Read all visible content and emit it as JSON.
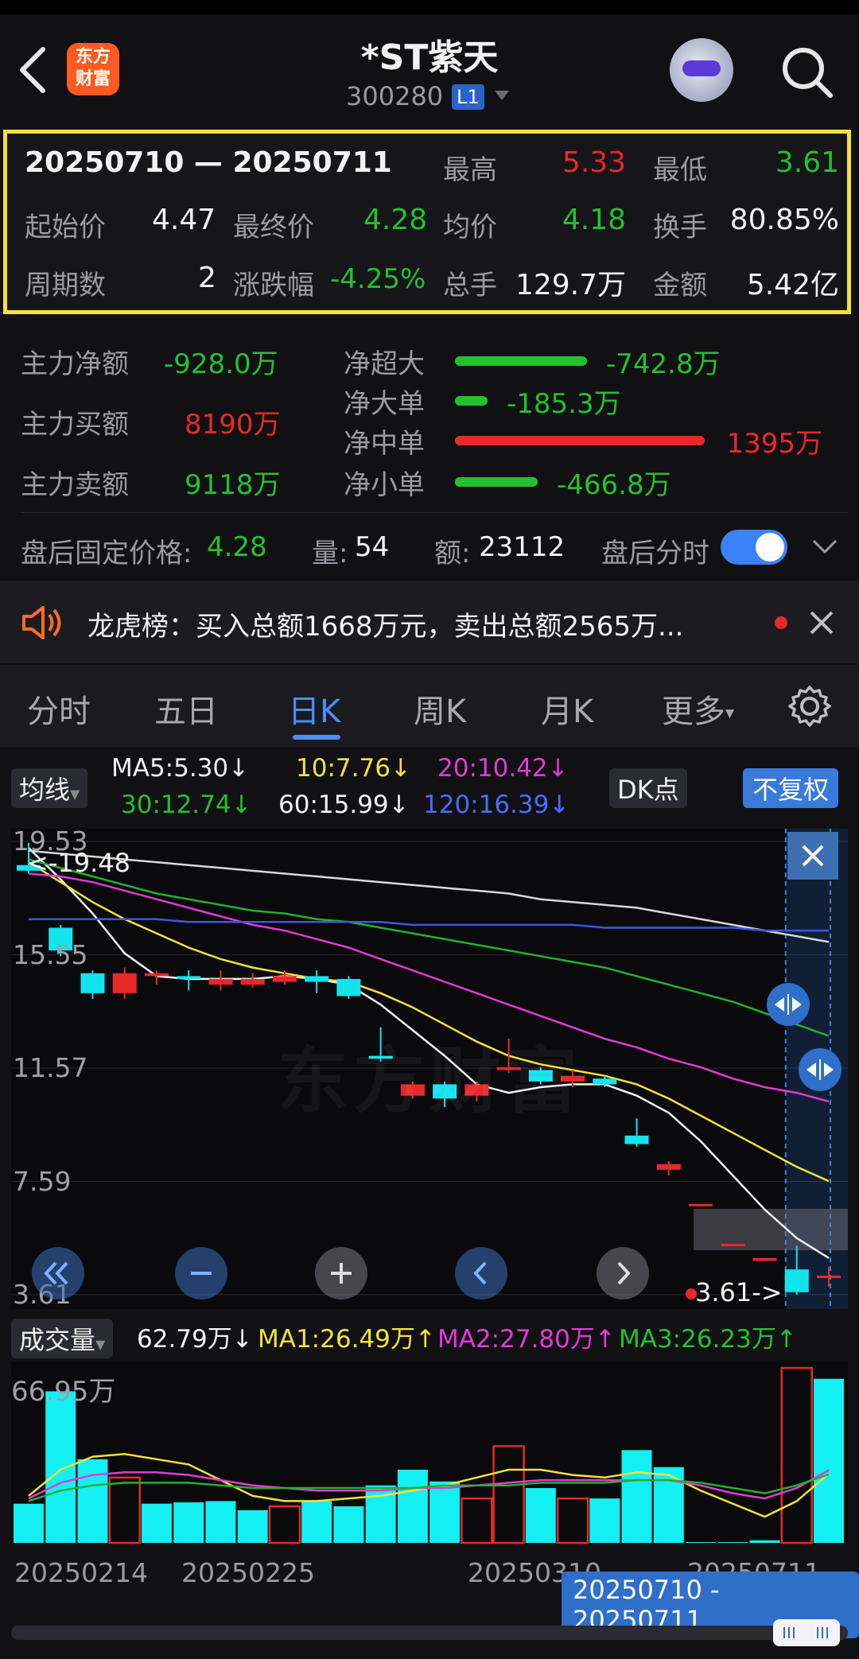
{
  "header": {
    "logo": "东方财富",
    "stock_name": "*ST紫天",
    "stock_code": "300280",
    "level_badge": "L1"
  },
  "summary": {
    "date_range": "20250710 — 20250711",
    "high_label": "最高",
    "high": "5.33",
    "low_label": "最低",
    "low": "3.61",
    "open_label": "起始价",
    "open": "4.47",
    "close_label": "最终价",
    "close": "4.28",
    "avg_label": "均价",
    "avg": "4.18",
    "turnover_label": "换手",
    "turnover": "80.85%",
    "periods_label": "周期数",
    "periods": "2",
    "change_label": "涨跌幅",
    "change": "-4.25%",
    "total_hands_label": "总手",
    "total_hands": "129.7万",
    "amount_label": "金额",
    "amount": "5.42亿"
  },
  "fund_flow": {
    "net_label": "主力净额",
    "net": "-928.0万",
    "buy_label": "主力买额",
    "buy": "8190万",
    "sell_label": "主力卖额",
    "sell": "9118万",
    "rows": [
      {
        "label": "净超大",
        "value": "-742.8万",
        "level": 0.53,
        "color": "green"
      },
      {
        "label": "净大单",
        "value": "-185.3万",
        "level": 0.13,
        "color": "green"
      },
      {
        "label": "净中单",
        "value": "1395万",
        "level": 1.0,
        "color": "red"
      },
      {
        "label": "净小单",
        "value": "-466.8万",
        "level": 0.33,
        "color": "green"
      }
    ]
  },
  "after_hours": {
    "price_label": "盘后固定价格:",
    "price": "4.28",
    "volume_label": "量:",
    "volume": "54",
    "amount_label": "额:",
    "amount": "23112",
    "timeshare_label": "盘后分时",
    "toggle_on": true
  },
  "notice": {
    "text": "龙虎榜：买入总额1668万元，卖出总额2565万..."
  },
  "tabs": [
    {
      "label": "分时"
    },
    {
      "label": "五日"
    },
    {
      "label": "日K"
    },
    {
      "label": "周K"
    },
    {
      "label": "月K"
    },
    {
      "label": "更多"
    }
  ],
  "active_tab": "日K",
  "ma_bar": {
    "selector": "均线",
    "ma5": "MA5:5.30↓",
    "ma10": "10:7.76↓",
    "ma20": "20:10.42↓",
    "ma30": "30:12.74↓",
    "ma60": "60:15.99↓",
    "ma120": "120:16.39↓",
    "dk_button": "DK点",
    "adjust_button": "不复权"
  },
  "kline": {
    "y_ticks": [
      "19.53",
      "15.55",
      "11.57",
      "7.59",
      "3.61"
    ],
    "max_marker": "<-19.48",
    "min_marker": "3.61->",
    "watermark": "东方财富"
  },
  "volume": {
    "selector": "成交量",
    "value": "62.79万↓",
    "ma1": "MA1:26.49万↑",
    "ma2": "MA2:27.80万↑",
    "ma3": "MA3:26.23万↑",
    "max_label": "66.95万",
    "x_ticks": [
      "20250214",
      "20250225",
      "20250310",
      "20250711"
    ]
  },
  "selected_range": "20250710 - 20250711",
  "colors": {
    "up": "#e8282a",
    "down": "#24c02e",
    "accent": "#3b82f6",
    "highlight_box": "#f4e23a"
  },
  "chart_data": {
    "type": "candlestick",
    "ylim": [
      3.61,
      19.53
    ],
    "candles": [
      {
        "o": 18.7,
        "c": 18.5,
        "h": 19.48,
        "l": 18.4
      },
      {
        "o": 16.5,
        "c": 15.7,
        "h": 16.6,
        "l": 15.5
      },
      {
        "o": 14.9,
        "c": 14.2,
        "h": 15.0,
        "l": 14.0
      },
      {
        "o": 14.2,
        "c": 14.9,
        "h": 15.1,
        "l": 14.0
      },
      {
        "o": 14.8,
        "c": 14.9,
        "h": 15.0,
        "l": 14.5
      },
      {
        "o": 14.8,
        "c": 14.7,
        "h": 15.0,
        "l": 14.3
      },
      {
        "o": 14.5,
        "c": 14.7,
        "h": 15.0,
        "l": 14.3
      },
      {
        "o": 14.5,
        "c": 14.7,
        "h": 14.9,
        "l": 14.4
      },
      {
        "o": 14.6,
        "c": 14.8,
        "h": 15.0,
        "l": 14.5
      },
      {
        "o": 14.8,
        "c": 14.6,
        "h": 15.0,
        "l": 14.2
      },
      {
        "o": 14.7,
        "c": 14.1,
        "h": 14.8,
        "l": 14.0
      },
      {
        "o": 12.0,
        "c": 11.9,
        "h": 13.0,
        "l": 11.8
      },
      {
        "o": 10.6,
        "c": 11.0,
        "h": 11.1,
        "l": 10.5
      },
      {
        "o": 11.0,
        "c": 10.5,
        "h": 11.1,
        "l": 10.2
      },
      {
        "o": 10.6,
        "c": 11.0,
        "h": 11.1,
        "l": 10.4
      },
      {
        "o": 11.5,
        "c": 11.6,
        "h": 12.6,
        "l": 11.4
      },
      {
        "o": 11.5,
        "c": 11.1,
        "h": 11.6,
        "l": 11.0
      },
      {
        "o": 11.1,
        "c": 11.3,
        "h": 11.5,
        "l": 10.9
      },
      {
        "o": 11.2,
        "c": 11.0,
        "h": 11.3,
        "l": 10.9
      },
      {
        "o": 9.2,
        "c": 8.9,
        "h": 9.8,
        "l": 8.8
      },
      {
        "o": 8.0,
        "c": 8.2,
        "h": 8.3,
        "l": 7.8
      },
      {
        "o": 6.8,
        "c": 6.8,
        "h": 6.8,
        "l": 6.8
      },
      {
        "o": 5.4,
        "c": 5.4,
        "h": 5.4,
        "l": 5.4
      },
      {
        "o": 4.8,
        "c": 4.9,
        "h": 4.9,
        "l": 4.8
      },
      {
        "o": 4.5,
        "c": 3.7,
        "h": 5.33,
        "l": 3.61
      },
      {
        "o": 4.2,
        "c": 4.28,
        "h": 4.6,
        "l": 3.9
      }
    ],
    "ma_lines": [
      {
        "name": "MA5",
        "color": "#f2f2f2",
        "values": [
          19.3,
          18.2,
          17.0,
          15.6,
          14.8,
          14.7,
          14.7,
          14.7,
          14.8,
          14.7,
          14.5,
          13.8,
          12.9,
          12.0,
          11.0,
          10.7,
          10.9,
          11.0,
          11.0,
          10.6,
          10.0,
          9.0,
          7.8,
          6.6,
          5.6,
          4.9
        ]
      },
      {
        "name": "MA10",
        "color": "#f1e23a",
        "values": [
          18.8,
          18.1,
          17.4,
          16.8,
          16.3,
          15.8,
          15.4,
          15.1,
          14.9,
          14.7,
          14.6,
          14.2,
          13.7,
          13.1,
          12.5,
          12.0,
          11.7,
          11.5,
          11.3,
          11.0,
          10.5,
          9.9,
          9.3,
          8.7,
          8.1,
          7.6
        ]
      },
      {
        "name": "MA20",
        "color": "#e23ad5",
        "values": [
          18.4,
          18.3,
          18.1,
          17.8,
          17.5,
          17.2,
          16.9,
          16.6,
          16.4,
          16.1,
          15.8,
          15.4,
          15.0,
          14.6,
          14.2,
          13.8,
          13.4,
          13.0,
          12.6,
          12.3,
          11.9,
          11.6,
          11.2,
          10.9,
          10.7,
          10.4
        ]
      },
      {
        "name": "MA30",
        "color": "#24b02e",
        "values": [
          18.9,
          18.6,
          18.3,
          18.0,
          17.7,
          17.5,
          17.3,
          17.1,
          17.0,
          16.8,
          16.7,
          16.5,
          16.3,
          16.1,
          15.9,
          15.7,
          15.5,
          15.3,
          15.1,
          14.8,
          14.5,
          14.2,
          13.9,
          13.5,
          13.1,
          12.7
        ]
      },
      {
        "name": "MA60",
        "color": "#d8d8d8",
        "values": [
          19.2,
          19.1,
          19.0,
          18.9,
          18.8,
          18.7,
          18.6,
          18.5,
          18.4,
          18.3,
          18.2,
          18.1,
          18.0,
          17.9,
          17.8,
          17.7,
          17.5,
          17.4,
          17.3,
          17.2,
          17.0,
          16.8,
          16.6,
          16.4,
          16.2,
          16.0
        ]
      },
      {
        "name": "MA120",
        "color": "#3c56e6",
        "values": [
          16.8,
          16.8,
          16.8,
          16.8,
          16.8,
          16.7,
          16.7,
          16.7,
          16.7,
          16.7,
          16.7,
          16.7,
          16.6,
          16.6,
          16.6,
          16.6,
          16.6,
          16.6,
          16.5,
          16.5,
          16.5,
          16.5,
          16.5,
          16.4,
          16.4,
          16.4
        ]
      }
    ],
    "volume_ylim": [
      0,
      66.95
    ],
    "volumes": [
      {
        "v": 15.0,
        "up": false
      },
      {
        "v": 58.0,
        "up": false
      },
      {
        "v": 32.0,
        "up": false
      },
      {
        "v": 25.0,
        "up": true
      },
      {
        "v": 15.0,
        "up": false
      },
      {
        "v": 15.5,
        "up": false
      },
      {
        "v": 16.0,
        "up": false
      },
      {
        "v": 12.5,
        "up": false
      },
      {
        "v": 14.0,
        "up": true
      },
      {
        "v": 16.0,
        "up": false
      },
      {
        "v": 14.0,
        "up": false
      },
      {
        "v": 22.0,
        "up": false
      },
      {
        "v": 28.0,
        "up": false
      },
      {
        "v": 23.5,
        "up": false
      },
      {
        "v": 17.0,
        "up": true
      },
      {
        "v": 37.0,
        "up": true
      },
      {
        "v": 21.0,
        "up": false
      },
      {
        "v": 17.0,
        "up": true
      },
      {
        "v": 17.0,
        "up": false
      },
      {
        "v": 35.5,
        "up": false
      },
      {
        "v": 29.0,
        "up": false
      },
      {
        "v": 0.3,
        "up": false
      },
      {
        "v": 0.3,
        "up": false
      },
      {
        "v": 1.0,
        "up": false
      },
      {
        "v": 66.95,
        "up": true
      },
      {
        "v": 62.79,
        "up": false
      }
    ],
    "volume_ma": [
      {
        "name": "MA1",
        "color": "#f1e23a",
        "values": [
          18,
          28,
          33,
          34,
          32,
          30,
          24,
          18,
          16,
          16,
          17,
          18,
          20,
          22,
          25,
          28,
          28,
          26,
          25,
          27,
          26,
          20,
          15,
          10,
          16,
          26.49
        ]
      },
      {
        "name": "MA2",
        "color": "#e23ad5",
        "values": [
          17,
          23,
          26,
          27,
          27,
          26,
          24,
          22,
          21,
          20,
          20,
          20,
          21,
          21,
          22,
          23,
          24,
          24,
          24,
          24,
          24,
          22,
          19,
          17,
          21,
          27.8
        ]
      },
      {
        "name": "MA3",
        "color": "#24b02e",
        "values": [
          16,
          20,
          22,
          23,
          23,
          23,
          22,
          21,
          21,
          21,
          21,
          21,
          21,
          22,
          22,
          22,
          23,
          23,
          23,
          24,
          24,
          23,
          21,
          19,
          22,
          26.23
        ]
      }
    ]
  }
}
